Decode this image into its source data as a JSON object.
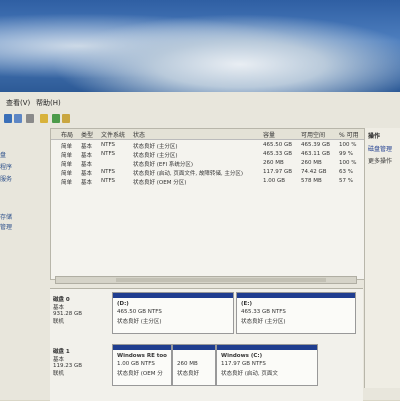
{
  "menu": {
    "items": [
      "查看(V)",
      "帮助(H)"
    ]
  },
  "left_nav": {
    "items": [
      "盘",
      "程序",
      "服务",
      "存储",
      "管理"
    ]
  },
  "volume_list": {
    "columns": [
      "布局",
      "类型",
      "文件系统",
      "状态",
      "容量",
      "可用空间",
      "% 可用"
    ],
    "rows": [
      {
        "layout": "简单",
        "type": "基本",
        "fs": "NTFS",
        "status": "状态良好 (主分区)",
        "capacity": "465.50 GB",
        "free": "465.39 GB",
        "pct": "100 %"
      },
      {
        "layout": "简单",
        "type": "基本",
        "fs": "NTFS",
        "status": "状态良好 (主分区)",
        "capacity": "465.33 GB",
        "free": "463.11 GB",
        "pct": "99 %"
      },
      {
        "layout": "简单",
        "type": "基本",
        "fs": "",
        "status": "状态良好 (EFI 系统分区)",
        "capacity": "260 MB",
        "free": "260 MB",
        "pct": "100 %"
      },
      {
        "layout": "简单",
        "type": "基本",
        "fs": "NTFS",
        "status": "状态良好 (启动, 页面文件, 故障转储, 主分区)",
        "capacity": "117.97 GB",
        "free": "74.42 GB",
        "pct": "63 %"
      },
      {
        "layout": "简单",
        "type": "基本",
        "fs": "NTFS",
        "status": "状态良好 (OEM 分区)",
        "capacity": "1.00 GB",
        "free": "578 MB",
        "pct": "57 %"
      }
    ]
  },
  "actions": {
    "title": "操作",
    "items": [
      "磁盘管理",
      "更多操作"
    ]
  },
  "disks": [
    {
      "name": "磁盘 0",
      "type": "基本",
      "size": "931.28 GB",
      "state": "联机",
      "partitions": [
        {
          "name": "(D:)",
          "size": "465.50 GB NTFS",
          "status": "状态良好 (主分区)"
        },
        {
          "name": "(E:)",
          "size": "465.33 GB NTFS",
          "status": "状态良好 (主分区)"
        }
      ]
    },
    {
      "name": "磁盘 1",
      "type": "基本",
      "size": "119.23 GB",
      "state": "联机",
      "partitions": [
        {
          "name": "Windows RE too",
          "size": "1.00 GB NTFS",
          "status": "状态良好 (OEM 分"
        },
        {
          "name": "",
          "size": "260 MB",
          "status": "状态良好"
        },
        {
          "name": "Windows (C:)",
          "size": "117.97 GB NTFS",
          "status": "状态良好 (启动, 页面文"
        }
      ]
    }
  ],
  "colors": {
    "partition_bar": "#1f3d8f",
    "window_bg": "#e8e6dc"
  }
}
